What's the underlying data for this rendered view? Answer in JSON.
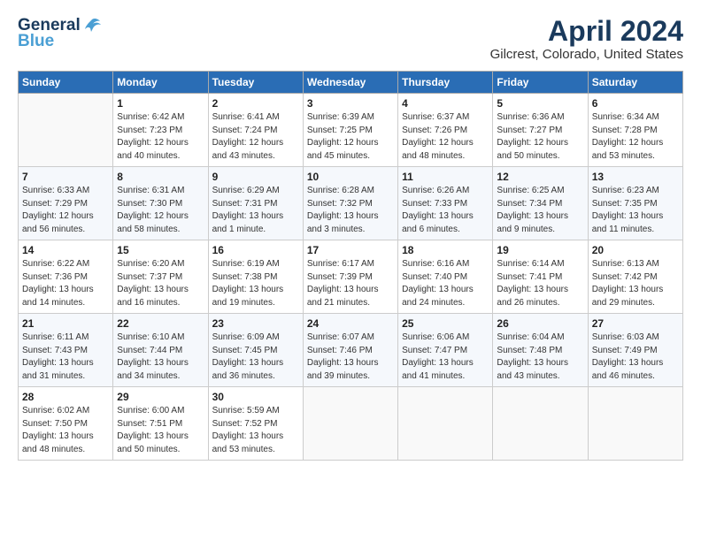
{
  "header": {
    "logo_line1": "General",
    "logo_line2": "Blue",
    "title": "April 2024",
    "subtitle": "Gilcrest, Colorado, United States"
  },
  "columns": [
    "Sunday",
    "Monday",
    "Tuesday",
    "Wednesday",
    "Thursday",
    "Friday",
    "Saturday"
  ],
  "weeks": [
    [
      {
        "day": "",
        "info": ""
      },
      {
        "day": "1",
        "info": "Sunrise: 6:42 AM\nSunset: 7:23 PM\nDaylight: 12 hours\nand 40 minutes."
      },
      {
        "day": "2",
        "info": "Sunrise: 6:41 AM\nSunset: 7:24 PM\nDaylight: 12 hours\nand 43 minutes."
      },
      {
        "day": "3",
        "info": "Sunrise: 6:39 AM\nSunset: 7:25 PM\nDaylight: 12 hours\nand 45 minutes."
      },
      {
        "day": "4",
        "info": "Sunrise: 6:37 AM\nSunset: 7:26 PM\nDaylight: 12 hours\nand 48 minutes."
      },
      {
        "day": "5",
        "info": "Sunrise: 6:36 AM\nSunset: 7:27 PM\nDaylight: 12 hours\nand 50 minutes."
      },
      {
        "day": "6",
        "info": "Sunrise: 6:34 AM\nSunset: 7:28 PM\nDaylight: 12 hours\nand 53 minutes."
      }
    ],
    [
      {
        "day": "7",
        "info": "Sunrise: 6:33 AM\nSunset: 7:29 PM\nDaylight: 12 hours\nand 56 minutes."
      },
      {
        "day": "8",
        "info": "Sunrise: 6:31 AM\nSunset: 7:30 PM\nDaylight: 12 hours\nand 58 minutes."
      },
      {
        "day": "9",
        "info": "Sunrise: 6:29 AM\nSunset: 7:31 PM\nDaylight: 13 hours\nand 1 minute."
      },
      {
        "day": "10",
        "info": "Sunrise: 6:28 AM\nSunset: 7:32 PM\nDaylight: 13 hours\nand 3 minutes."
      },
      {
        "day": "11",
        "info": "Sunrise: 6:26 AM\nSunset: 7:33 PM\nDaylight: 13 hours\nand 6 minutes."
      },
      {
        "day": "12",
        "info": "Sunrise: 6:25 AM\nSunset: 7:34 PM\nDaylight: 13 hours\nand 9 minutes."
      },
      {
        "day": "13",
        "info": "Sunrise: 6:23 AM\nSunset: 7:35 PM\nDaylight: 13 hours\nand 11 minutes."
      }
    ],
    [
      {
        "day": "14",
        "info": "Sunrise: 6:22 AM\nSunset: 7:36 PM\nDaylight: 13 hours\nand 14 minutes."
      },
      {
        "day": "15",
        "info": "Sunrise: 6:20 AM\nSunset: 7:37 PM\nDaylight: 13 hours\nand 16 minutes."
      },
      {
        "day": "16",
        "info": "Sunrise: 6:19 AM\nSunset: 7:38 PM\nDaylight: 13 hours\nand 19 minutes."
      },
      {
        "day": "17",
        "info": "Sunrise: 6:17 AM\nSunset: 7:39 PM\nDaylight: 13 hours\nand 21 minutes."
      },
      {
        "day": "18",
        "info": "Sunrise: 6:16 AM\nSunset: 7:40 PM\nDaylight: 13 hours\nand 24 minutes."
      },
      {
        "day": "19",
        "info": "Sunrise: 6:14 AM\nSunset: 7:41 PM\nDaylight: 13 hours\nand 26 minutes."
      },
      {
        "day": "20",
        "info": "Sunrise: 6:13 AM\nSunset: 7:42 PM\nDaylight: 13 hours\nand 29 minutes."
      }
    ],
    [
      {
        "day": "21",
        "info": "Sunrise: 6:11 AM\nSunset: 7:43 PM\nDaylight: 13 hours\nand 31 minutes."
      },
      {
        "day": "22",
        "info": "Sunrise: 6:10 AM\nSunset: 7:44 PM\nDaylight: 13 hours\nand 34 minutes."
      },
      {
        "day": "23",
        "info": "Sunrise: 6:09 AM\nSunset: 7:45 PM\nDaylight: 13 hours\nand 36 minutes."
      },
      {
        "day": "24",
        "info": "Sunrise: 6:07 AM\nSunset: 7:46 PM\nDaylight: 13 hours\nand 39 minutes."
      },
      {
        "day": "25",
        "info": "Sunrise: 6:06 AM\nSunset: 7:47 PM\nDaylight: 13 hours\nand 41 minutes."
      },
      {
        "day": "26",
        "info": "Sunrise: 6:04 AM\nSunset: 7:48 PM\nDaylight: 13 hours\nand 43 minutes."
      },
      {
        "day": "27",
        "info": "Sunrise: 6:03 AM\nSunset: 7:49 PM\nDaylight: 13 hours\nand 46 minutes."
      }
    ],
    [
      {
        "day": "28",
        "info": "Sunrise: 6:02 AM\nSunset: 7:50 PM\nDaylight: 13 hours\nand 48 minutes."
      },
      {
        "day": "29",
        "info": "Sunrise: 6:00 AM\nSunset: 7:51 PM\nDaylight: 13 hours\nand 50 minutes."
      },
      {
        "day": "30",
        "info": "Sunrise: 5:59 AM\nSunset: 7:52 PM\nDaylight: 13 hours\nand 53 minutes."
      },
      {
        "day": "",
        "info": ""
      },
      {
        "day": "",
        "info": ""
      },
      {
        "day": "",
        "info": ""
      },
      {
        "day": "",
        "info": ""
      }
    ]
  ]
}
